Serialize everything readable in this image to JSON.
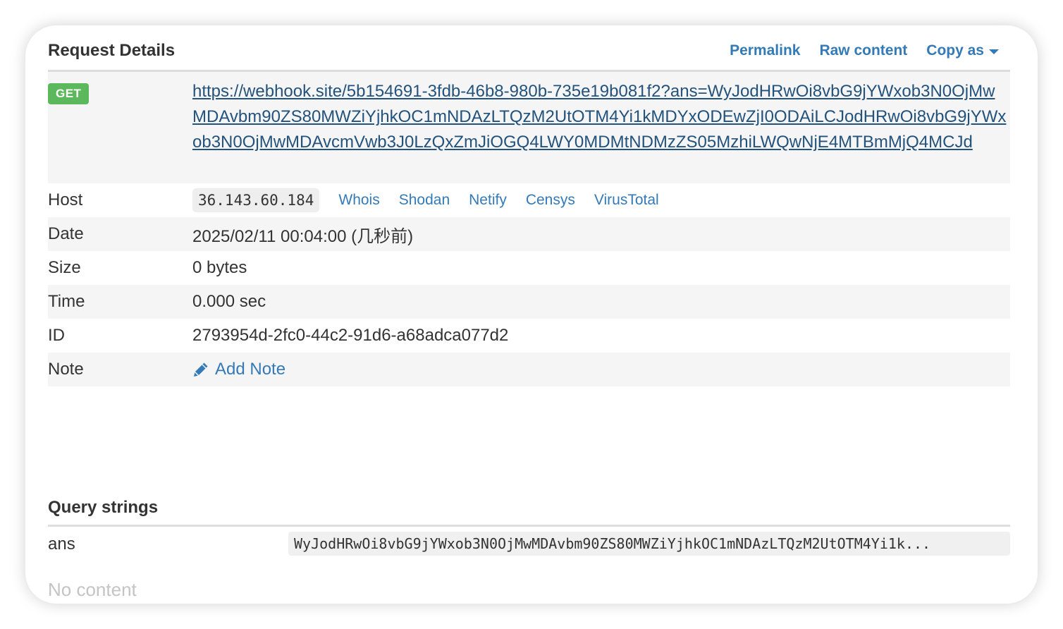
{
  "request_details": {
    "title": "Request Details",
    "links": {
      "permalink": "Permalink",
      "raw_content": "Raw content",
      "copy_as": "Copy as"
    },
    "method": "GET",
    "method_color": "#5cb85c",
    "url": "https://webhook.site/5b154691-3fdb-46b8-980b-735e19b081f2?ans=WyJodHRwOi8vbG9jYWxob3N0OjMwMDAvbm90ZS80MWZiYjhkOC1mNDAzLTQzM2UtOTM4Yi1kMDYxODEwZjI0ODAiLCJodHRwOi8vbG9jYWxob3N0OjMwMDAvcmVwb3J0LzQxZmJiOGQ4LWY0MDMtNDMzZS05MzhiLWQwNjE4MTBmMjQ4MCJd",
    "rows": {
      "host": {
        "label": "Host",
        "ip": "36.143.60.184",
        "lookups": [
          "Whois",
          "Shodan",
          "Netify",
          "Censys",
          "VirusTotal"
        ]
      },
      "date": {
        "label": "Date",
        "value": "2025/02/11 00:04:00 (几秒前)"
      },
      "size": {
        "label": "Size",
        "value": "0 bytes"
      },
      "time": {
        "label": "Time",
        "value": "0.000 sec"
      },
      "id": {
        "label": "ID",
        "value": "2793954d-2fc0-44c2-91d6-a68adca077d2"
      },
      "note": {
        "label": "Note",
        "action": "Add Note",
        "icon": "pencil-icon"
      }
    }
  },
  "query_strings": {
    "title": "Query strings",
    "items": [
      {
        "key": "ans",
        "value": "WyJodHRwOi8vbG9jYWxob3N0OjMwMDAvbm90ZS80MWZiYjhkOC1mNDAzLTQzM2UtOTM4Yi1k..."
      }
    ]
  },
  "body": {
    "empty_text": "No content"
  },
  "colors": {
    "link": "#337ab7",
    "url_link": "#23527c",
    "stripe": "#f5f5f5",
    "muted": "#c4c4c4"
  }
}
